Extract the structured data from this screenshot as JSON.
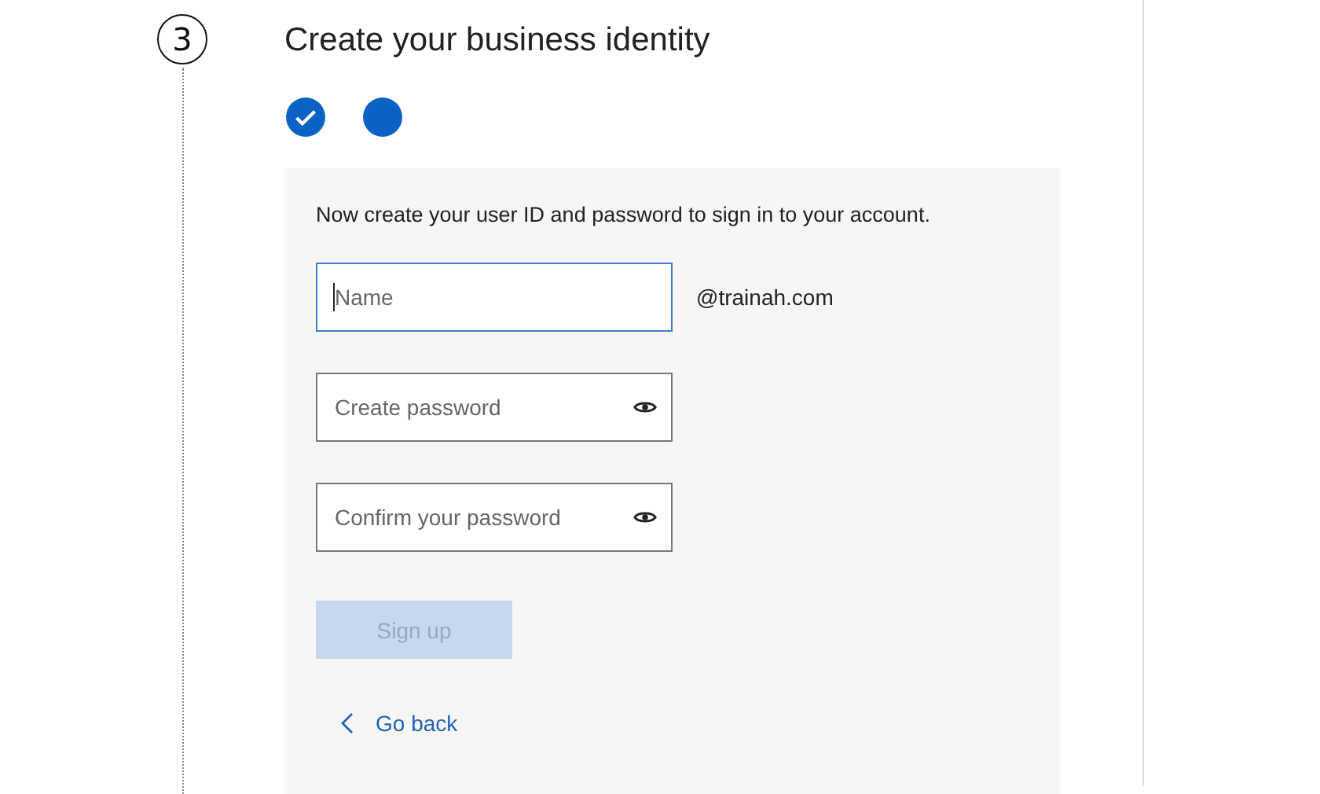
{
  "step": {
    "number": "3",
    "title": "Create your business identity"
  },
  "progress": [
    {
      "done": true
    },
    {
      "done": false
    }
  ],
  "form": {
    "instruction": "Now create your user ID and password to sign in to your account.",
    "fields": [
      {
        "kind": "text",
        "placeholder": "Name",
        "focused": true,
        "suffix": "@trainah.com"
      },
      {
        "kind": "password",
        "placeholder": "Create password",
        "focused": false
      },
      {
        "kind": "password",
        "placeholder": "Confirm your password",
        "focused": false
      }
    ],
    "submit": {
      "label": "Sign up",
      "disabled": true
    },
    "back": {
      "label": "Go back"
    }
  }
}
